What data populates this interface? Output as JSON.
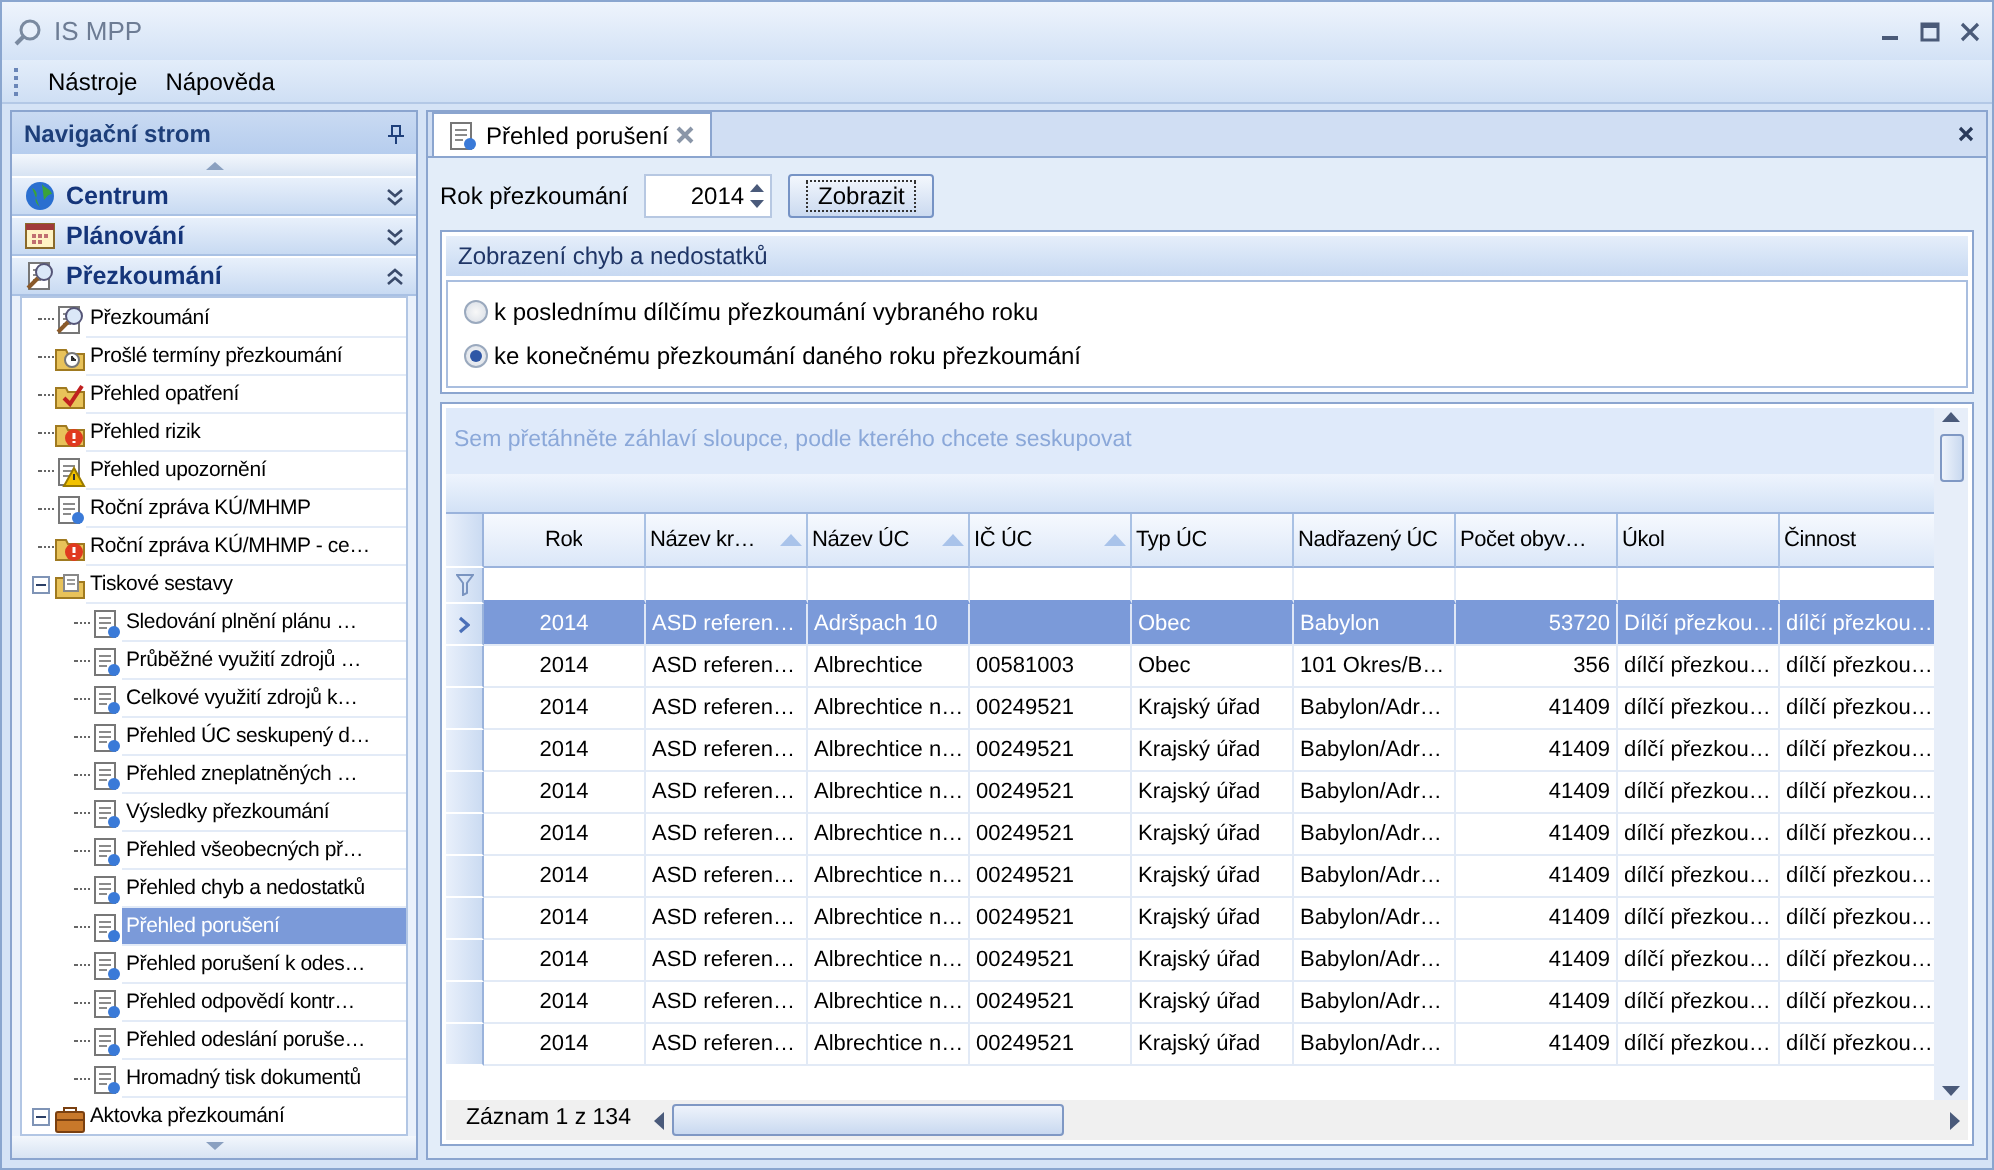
{
  "window": {
    "title": "IS MPP"
  },
  "menu": [
    {
      "label": "Nástroje"
    },
    {
      "label": "Nápověda"
    }
  ],
  "navigation": {
    "title": "Navigační strom",
    "sections": [
      {
        "label": "Centrum",
        "kind": "globe",
        "expanded": false
      },
      {
        "label": "Plánování",
        "kind": "calendar",
        "expanded": false
      },
      {
        "label": "Přezkoumání",
        "kind": "magnifier",
        "expanded": true,
        "tree": [
          {
            "label": "Přezkoumání",
            "kind": "magnifier",
            "selected": false
          },
          {
            "label": "Prošlé termíny přezkoumání",
            "kind": "clock",
            "selected": false
          },
          {
            "label": "Přehled opatření",
            "kind": "check",
            "selected": false
          },
          {
            "label": "Přehled rizik",
            "kind": "alert",
            "selected": false
          },
          {
            "label": "Přehled upozornění",
            "kind": "warning",
            "selected": false
          },
          {
            "label": "Roční zpráva KÚ/MHMP",
            "kind": "report",
            "selected": false
          },
          {
            "label": "Roční zpráva KÚ/MHMP - ce…",
            "kind": "alert",
            "selected": false
          },
          {
            "label": "Tiskové sestavy",
            "kind": "printer",
            "selected": false,
            "expanded": true,
            "children": [
              {
                "label": "Sledování plnění plánu …",
                "kind": "report",
                "selected": false
              },
              {
                "label": "Průběžné využití zdrojů …",
                "kind": "report",
                "selected": false
              },
              {
                "label": "Celkové využití zdrojů k…",
                "kind": "report",
                "selected": false
              },
              {
                "label": "Přehled ÚC seskupený d…",
                "kind": "report",
                "selected": false
              },
              {
                "label": "Přehled zneplatněných …",
                "kind": "report",
                "selected": false
              },
              {
                "label": "Výsledky přezkoumání",
                "kind": "report",
                "selected": false
              },
              {
                "label": "Přehled všeobecných př…",
                "kind": "report",
                "selected": false
              },
              {
                "label": "Přehled chyb a nedostatků",
                "kind": "report",
                "selected": false
              },
              {
                "label": "Přehled porušení",
                "kind": "report",
                "selected": true
              },
              {
                "label": "Přehled porušení k odes…",
                "kind": "report",
                "selected": false
              },
              {
                "label": "Přehled odpovědí kontr…",
                "kind": "report",
                "selected": false
              },
              {
                "label": "Přehled odeslání poruše…",
                "kind": "report",
                "selected": false
              },
              {
                "label": "Hromadný tisk dokumentů",
                "kind": "report",
                "selected": false
              }
            ]
          },
          {
            "label": "Aktovka přezkoumání",
            "kind": "briefcase",
            "selected": false,
            "expanded": true
          }
        ]
      }
    ]
  },
  "tabs": [
    {
      "label": "Přehled porušení",
      "selected": true
    }
  ],
  "year_filter": {
    "label": "Rok přezkoumání",
    "value": "2014",
    "button": "Zobrazit"
  },
  "display_group": {
    "title": "Zobrazení chyb a nedostatků",
    "options": [
      {
        "label": "k poslednímu dílčímu přezkoumání vybraného roku",
        "selected": false
      },
      {
        "label": "ke konečnému přezkoumání daného roku přezkoumání",
        "selected": true
      }
    ]
  },
  "grid": {
    "group_hint": "Sem přetáhněte záhlaví sloupce, podle kterého chcete seskupovat",
    "columns": [
      {
        "label": "Rok",
        "kind": "center",
        "sorted": false
      },
      {
        "label": "Název kr…",
        "kind": "text",
        "sorted": true
      },
      {
        "label": "Název ÚC",
        "kind": "text",
        "sorted": true
      },
      {
        "label": "IČ ÚC",
        "kind": "text",
        "sorted": true
      },
      {
        "label": "Typ ÚC",
        "kind": "text",
        "sorted": false
      },
      {
        "label": "Nadřazený ÚC",
        "kind": "text",
        "sorted": false
      },
      {
        "label": "Počet obyv…",
        "kind": "number",
        "sorted": false
      },
      {
        "label": "Úkol",
        "kind": "text",
        "sorted": false
      },
      {
        "label": "Činnost",
        "kind": "text",
        "sorted": false
      }
    ],
    "rows": [
      {
        "selected": true,
        "cells": [
          "2014",
          "ASD referen…",
          "Adršpach 10",
          null,
          "Obec",
          "Babylon",
          "53720",
          "Dílčí přezkou…",
          "dílčí přezkou…"
        ]
      },
      {
        "selected": false,
        "cells": [
          "2014",
          "ASD referen…",
          "Albrechtice",
          "00581003",
          "Obec",
          "101 Okres/B…",
          "356",
          "dílčí přezkou…",
          "dílčí přezkou…"
        ]
      },
      {
        "selected": false,
        "cells": [
          "2014",
          "ASD referen…",
          "Albrechtice n…",
          "00249521",
          "Krajský úřad",
          "Babylon/Adr…",
          "41409",
          "dílčí přezkou…",
          "dílčí přezkou…"
        ]
      },
      {
        "selected": false,
        "cells": [
          "2014",
          "ASD referen…",
          "Albrechtice n…",
          "00249521",
          "Krajský úřad",
          "Babylon/Adr…",
          "41409",
          "dílčí přezkou…",
          "dílčí přezkou…"
        ]
      },
      {
        "selected": false,
        "cells": [
          "2014",
          "ASD referen…",
          "Albrechtice n…",
          "00249521",
          "Krajský úřad",
          "Babylon/Adr…",
          "41409",
          "dílčí přezkou…",
          "dílčí přezkou…"
        ]
      },
      {
        "selected": false,
        "cells": [
          "2014",
          "ASD referen…",
          "Albrechtice n…",
          "00249521",
          "Krajský úřad",
          "Babylon/Adr…",
          "41409",
          "dílčí přezkou…",
          "dílčí přezkou…"
        ]
      },
      {
        "selected": false,
        "cells": [
          "2014",
          "ASD referen…",
          "Albrechtice n…",
          "00249521",
          "Krajský úřad",
          "Babylon/Adr…",
          "41409",
          "dílčí přezkou…",
          "dílčí přezkou…"
        ]
      },
      {
        "selected": false,
        "cells": [
          "2014",
          "ASD referen…",
          "Albrechtice n…",
          "00249521",
          "Krajský úřad",
          "Babylon/Adr…",
          "41409",
          "dílčí přezkou…",
          "dílčí přezkou…"
        ]
      },
      {
        "selected": false,
        "cells": [
          "2014",
          "ASD referen…",
          "Albrechtice n…",
          "00249521",
          "Krajský úřad",
          "Babylon/Adr…",
          "41409",
          "dílčí přezkou…",
          "dílčí přezkou…"
        ]
      },
      {
        "selected": false,
        "cells": [
          "2014",
          "ASD referen…",
          "Albrechtice n…",
          "00249521",
          "Krajský úřad",
          "Babylon/Adr…",
          "41409",
          "dílčí přezkou…",
          "dílčí přezkou…"
        ]
      },
      {
        "selected": false,
        "cells": [
          "2014",
          "ASD referen…",
          "Albrechtice n…",
          "00249521",
          "Krajský úřad",
          "Babylon/Adr…",
          "41409",
          "dílčí přezkou…",
          "dílčí přezkou…"
        ]
      }
    ],
    "record_status": "Záznam 1 z 134"
  }
}
